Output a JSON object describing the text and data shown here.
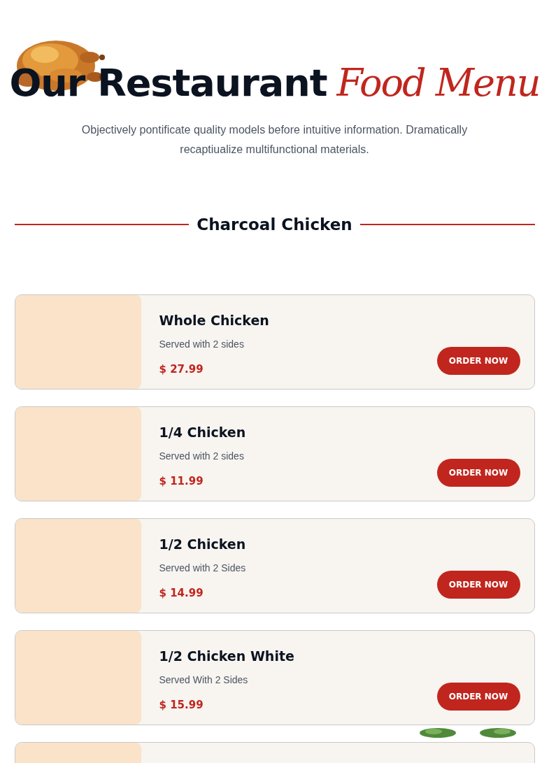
{
  "header": {
    "title": "Our Restaurant",
    "title_accent": "Food Menu",
    "subtitle": "Objectively pontificate quality models before intuitive information. Dramatically recaptiualize multifunctional materials."
  },
  "section": {
    "title": "Charcoal Chicken"
  },
  "items": [
    {
      "name": "Whole Chicken",
      "description": "Served with 2 sides",
      "price": "$ 27.99",
      "button": "ORDER NOW"
    },
    {
      "name": "1/4 Chicken",
      "description": "Served with 2 sides",
      "price": "$ 11.99",
      "button": "ORDER NOW"
    },
    {
      "name": "1/2 Chicken",
      "description": "Served with 2 Sides",
      "price": "$ 14.99",
      "button": "ORDER NOW"
    },
    {
      "name": "1/2 Chicken White",
      "description": "Served With 2 Sides",
      "price": "$ 15.99",
      "button": "ORDER NOW"
    }
  ]
}
